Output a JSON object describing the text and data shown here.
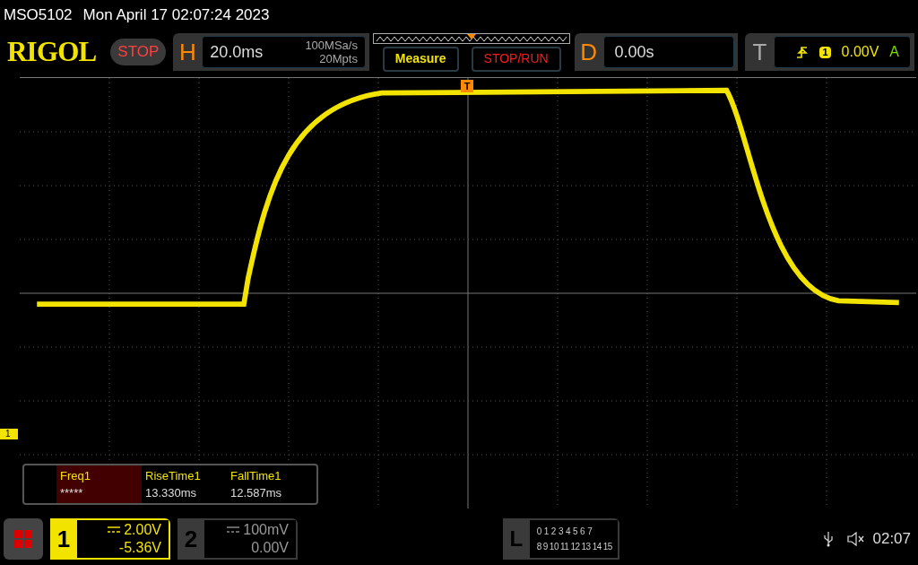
{
  "title_bar": {
    "model": "MSO5102",
    "datetime": "Mon April 17 02:07:24 2023"
  },
  "header": {
    "logo": "RIGOL",
    "run_state": "STOP",
    "horizontal": {
      "label": "H",
      "timebase": "20.0ms",
      "sample_rate": "100MSa/s",
      "memory_depth": "20Mpts"
    },
    "buttons": [
      {
        "label": "Measure",
        "kind": "measure"
      },
      {
        "label": "STOP/RUN",
        "kind": "stoprun"
      }
    ],
    "delay": {
      "label": "D",
      "value": "0.00s"
    },
    "trigger": {
      "label": "T",
      "source": "1",
      "level": "0.00V",
      "mode": "A"
    }
  },
  "display": {
    "trigger_marker": "T",
    "channel_marker": "1",
    "measurements": [
      {
        "name": "Freq1",
        "value": "*****",
        "selected": true
      },
      {
        "name": "RiseTime1",
        "value": "13.330ms",
        "selected": false
      },
      {
        "name": "FallTime1",
        "value": "12.587ms",
        "selected": false
      }
    ]
  },
  "bottom_bar": {
    "channels": [
      {
        "number": "1",
        "scale": "2.00V",
        "offset": "-5.36V",
        "active": true
      },
      {
        "number": "2",
        "scale": "100mV",
        "offset": "0.00V",
        "active": false
      }
    ],
    "logic": {
      "label": "L",
      "row_1": [
        "0",
        "1",
        "2",
        "3",
        "4",
        "5",
        "6",
        "7"
      ],
      "row_2": [
        "8",
        "9",
        "10",
        "11",
        "12",
        "13",
        "14",
        "15"
      ]
    },
    "clock": "02:07"
  }
}
